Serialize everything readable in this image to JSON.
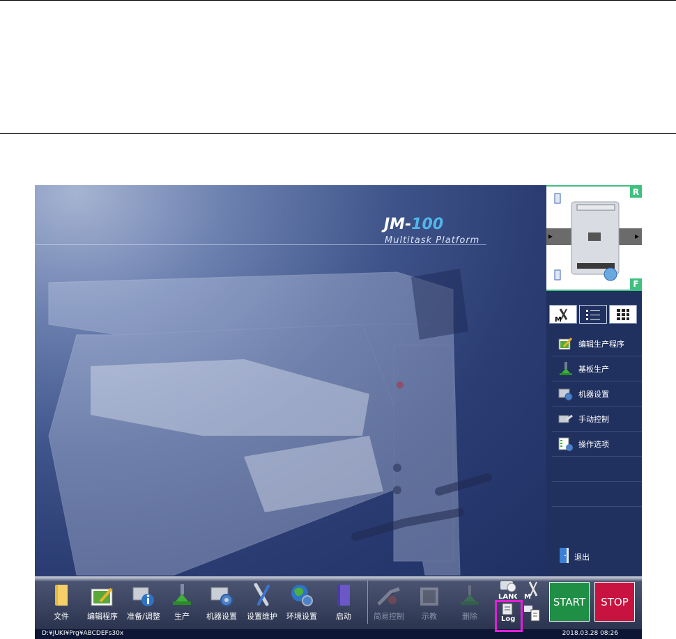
{
  "brand": {
    "model_prefix": "JM-",
    "model_number": "100",
    "subtitle": "Multitask Platform"
  },
  "machine_status": {
    "rear_label": "R",
    "front_label": "F"
  },
  "side_tabs": [
    {
      "icon": "manual-wrench-icon",
      "label": "M"
    },
    {
      "icon": "list-view-icon"
    },
    {
      "icon": "grid-view-icon"
    }
  ],
  "side_menu": [
    {
      "label": "编辑生产程序",
      "icon": "edit-program-icon"
    },
    {
      "label": "基板生产",
      "icon": "board-production-icon"
    },
    {
      "label": "机器设置",
      "icon": "machine-settings-icon"
    },
    {
      "label": "手动控制",
      "icon": "manual-control-icon"
    },
    {
      "label": "操作选项",
      "icon": "operation-options-icon"
    },
    {
      "label": ""
    },
    {
      "label": ""
    }
  ],
  "exit": {
    "label": "退出",
    "icon": "exit-door-icon"
  },
  "toolbar": {
    "items": [
      {
        "label": "文件",
        "icon": "folder-icon",
        "enabled": true
      },
      {
        "label": "编辑程序",
        "icon": "edit-program-icon",
        "enabled": true
      },
      {
        "label": "准备/调整",
        "icon": "prepare-adjust-icon",
        "enabled": true
      },
      {
        "label": "生产",
        "icon": "production-icon",
        "enabled": true
      },
      {
        "label": "机器设置",
        "icon": "machine-settings-icon",
        "enabled": true
      },
      {
        "label": "设置维护",
        "icon": "maintenance-icon",
        "enabled": true
      },
      {
        "label": "环境设置",
        "icon": "environment-globe-icon",
        "enabled": true
      },
      {
        "label": "启动",
        "icon": "book-icon",
        "enabled": true
      },
      {
        "label": "简易控制",
        "icon": "simple-control-icon",
        "enabled": false
      },
      {
        "label": "示教",
        "icon": "teach-icon",
        "enabled": false
      },
      {
        "label": "删除",
        "icon": "delete-icon",
        "enabled": false
      }
    ],
    "small": {
      "lang": "LANG",
      "manual": "M",
      "log": "Log"
    },
    "start_label": "START",
    "stop_label": "STOP"
  },
  "status_bar": {
    "path": "D:¥JUKI¥Prg¥ABCDEFs30x",
    "datetime": "2018.03.28 08:26"
  },
  "colors": {
    "background": "#1d2f5e",
    "accent": "#4fb6ea",
    "start": "#1f8f46",
    "stop": "#c8123f",
    "highlight": "#e020d8"
  }
}
